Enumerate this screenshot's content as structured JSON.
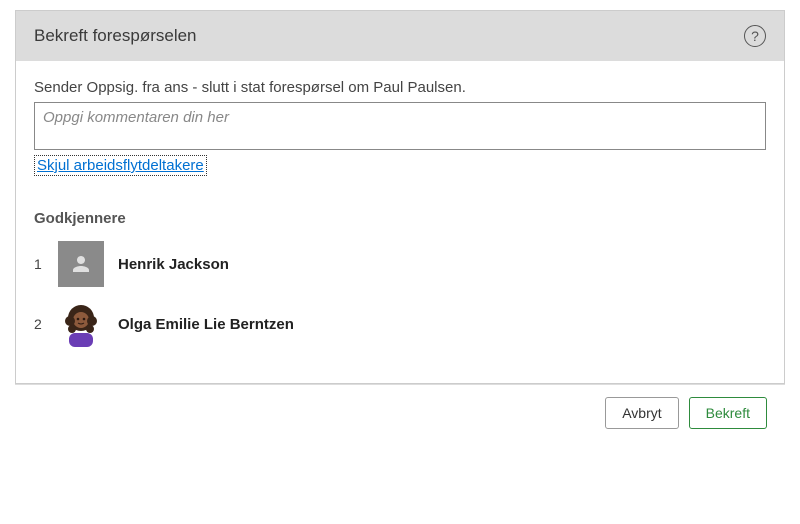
{
  "dialog": {
    "title": "Bekreft forespørselen",
    "senderText": "Sender Oppsig. fra ans - slutt i stat forespørsel om Paul Paulsen.",
    "commentPlaceholder": "Oppgi kommentaren din her",
    "toggleLink": "Skjul arbeidsflytdeltakere",
    "approversTitle": "Godkjennere"
  },
  "approvers": [
    {
      "index": "1",
      "name": "Henrik Jackson",
      "avatarType": "placeholder"
    },
    {
      "index": "2",
      "name": "Olga Emilie Lie Berntzen",
      "avatarType": "illustration"
    }
  ],
  "footer": {
    "cancel": "Avbryt",
    "confirm": "Bekreft"
  }
}
